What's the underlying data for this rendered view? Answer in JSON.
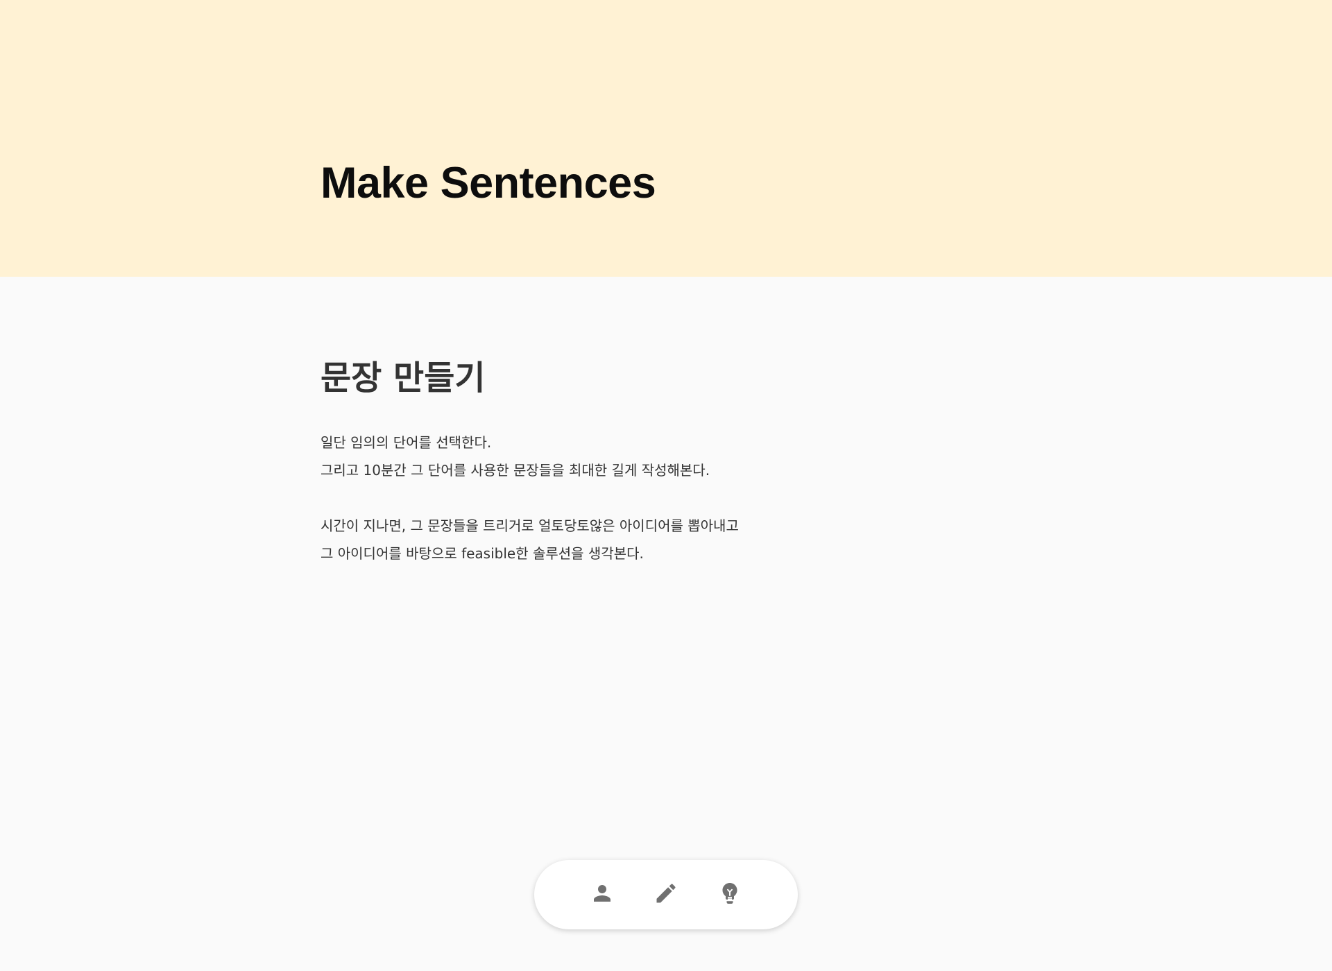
{
  "header": {
    "title": "Make Sentences"
  },
  "main": {
    "heading": "문장 만들기",
    "paragraphs": [
      {
        "lines": [
          "일단 임의의 단어를 선택한다.",
          "그리고 10분간 그 단어를 사용한 문장들을 최대한 길게 작성해본다."
        ]
      },
      {
        "lines": [
          "시간이 지나면, 그 문장들을 트리거로 얼토당토않은 아이디어를 뽑아내고",
          "그 아이디어를 바탕으로 feasible한 솔루션을 생각본다."
        ]
      }
    ]
  },
  "bottom_nav": {
    "items": [
      {
        "icon": "person-icon"
      },
      {
        "icon": "pencil-icon"
      },
      {
        "icon": "lightbulb-icon"
      }
    ]
  },
  "colors": {
    "hero_background": "#fff2d4",
    "page_background": "#fafafa",
    "icon_color": "#707070",
    "text_color": "#333333"
  }
}
